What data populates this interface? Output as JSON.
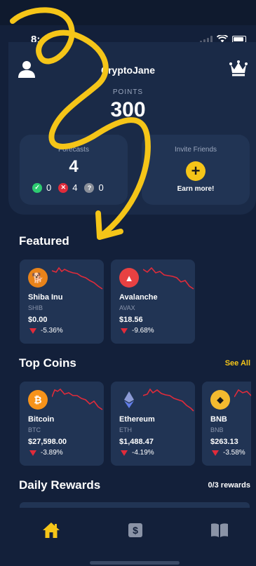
{
  "status": {
    "time": "8:"
  },
  "user": {
    "name": "CryptoJane",
    "points_label": "POINTS",
    "points": "300"
  },
  "forecasts": {
    "label": "Forecasts",
    "count": "4",
    "correct": "0",
    "wrong": "4",
    "pending": "0"
  },
  "invite": {
    "label": "Invite Friends",
    "cta": "Earn more!"
  },
  "sections": {
    "featured": "Featured",
    "top_coins": "Top Coins",
    "see_all": "See All",
    "daily_rewards": "Daily Rewards",
    "rewards_count": "0/3 rewards"
  },
  "featured": [
    {
      "name": "Shiba Inu",
      "symbol": "SHIB",
      "price": "$0.00",
      "change": "-5.36%",
      "logo": "shiba-icon",
      "color": "#e8831a"
    },
    {
      "name": "Avalanche",
      "symbol": "AVAX",
      "price": "$18.56",
      "change": "-9.68%",
      "logo": "avalanche-icon",
      "color": "#e84142"
    }
  ],
  "top_coins": [
    {
      "name": "Bitcoin",
      "symbol": "BTC",
      "price": "$27,598.00",
      "change": "-3.89%",
      "logo": "bitcoin-icon",
      "color": "#f7931a"
    },
    {
      "name": "Ethereum",
      "symbol": "ETH",
      "price": "$1,488.47",
      "change": "-4.19%",
      "logo": "ethereum-icon",
      "color": "#627eea"
    },
    {
      "name": "BNB",
      "symbol": "BNB",
      "price": "$263.13",
      "change": "-3.58%",
      "logo": "bnb-icon",
      "color": "#f3ba2f"
    }
  ],
  "tabs": [
    {
      "name": "home",
      "icon": "home-icon",
      "active": true
    },
    {
      "name": "wallet",
      "icon": "dollar-icon",
      "active": false
    },
    {
      "name": "learn",
      "icon": "book-icon",
      "active": false
    }
  ],
  "colors": {
    "accent": "#f5c518",
    "negative": "#e02b3a",
    "positive": "#2ecc71",
    "card": "#213454",
    "background": "#13203a"
  }
}
